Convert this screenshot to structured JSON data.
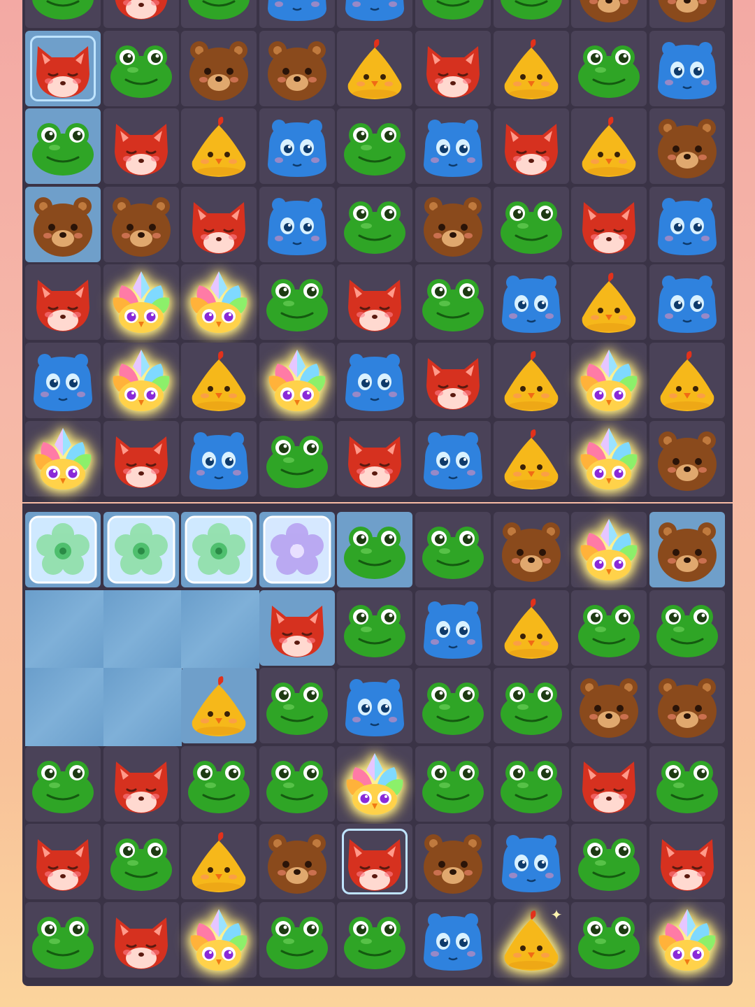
{
  "screen": {
    "title": ""
  },
  "palette": {
    "board": "#3a3346",
    "cell": "#4a4258",
    "ice": "#6f9fca",
    "fox": "#d6311f",
    "frog": "#2fa526",
    "bear": "#8a4a1c",
    "hippo": "#2f82de",
    "chick": "#f6b81a"
  },
  "top_board": {
    "rows": [
      [
        "frog",
        "fox",
        "frog",
        "hippo",
        "hippo",
        "frog",
        "frog",
        "bear",
        "bear"
      ],
      [
        "fox",
        "frog",
        "bear",
        "bear",
        "chick",
        "fox",
        "chick",
        "frog",
        "hippo"
      ],
      [
        "frog",
        "fox",
        "chick",
        "hippo",
        "frog",
        "hippo",
        "fox",
        "chick",
        "bear"
      ],
      [
        "bear",
        "bear",
        "fox",
        "hippo",
        "frog",
        "bear",
        "frog",
        "fox",
        "hippo"
      ],
      [
        "fox",
        "owl",
        "owl",
        "frog",
        "fox",
        "frog",
        "hippo",
        "chick",
        "hippo"
      ],
      [
        "hippo",
        "owl",
        "chick",
        "owl",
        "hippo",
        "fox",
        "chick",
        "owl",
        "chick"
      ],
      [
        "owl",
        "fox",
        "hippo",
        "frog",
        "fox",
        "hippo",
        "chick",
        "owl",
        "bear"
      ]
    ],
    "ice_cells": [
      [
        1,
        0
      ],
      [
        2,
        0
      ],
      [
        3,
        0
      ]
    ],
    "selected_cell": [
      1,
      0
    ]
  },
  "bottom_board": {
    "rows": [
      [
        "flower-green",
        "flower-green",
        "flower-green",
        "flower-purple",
        "frog",
        "frog",
        "bear",
        "owl",
        "bear"
      ],
      [
        "empty",
        "empty",
        "empty",
        "fox",
        "frog",
        "hippo",
        "chick",
        "frog",
        "frog"
      ],
      [
        "empty",
        "empty",
        "chick",
        "frog",
        "hippo",
        "frog",
        "frog",
        "bear",
        "bear"
      ],
      [
        "frog",
        "fox",
        "frog",
        "frog",
        "owl",
        "frog",
        "frog",
        "fox",
        "frog"
      ],
      [
        "fox",
        "frog",
        "chick",
        "bear",
        "fox",
        "bear",
        "hippo",
        "frog",
        "fox"
      ],
      [
        "frog",
        "fox",
        "owl",
        "frog",
        "frog",
        "hippo",
        "chick",
        "frog",
        "owl"
      ]
    ],
    "ice_cells": [
      [
        0,
        0
      ],
      [
        0,
        1
      ],
      [
        0,
        2
      ],
      [
        0,
        3
      ],
      [
        0,
        4
      ],
      [
        0,
        8
      ],
      [
        1,
        0
      ],
      [
        1,
        1
      ],
      [
        1,
        2
      ],
      [
        1,
        3
      ],
      [
        2,
        0
      ],
      [
        2,
        1
      ],
      [
        2,
        2
      ]
    ],
    "selected_cell": [
      4,
      4
    ],
    "highlighted_cell": [
      5,
      6
    ]
  }
}
